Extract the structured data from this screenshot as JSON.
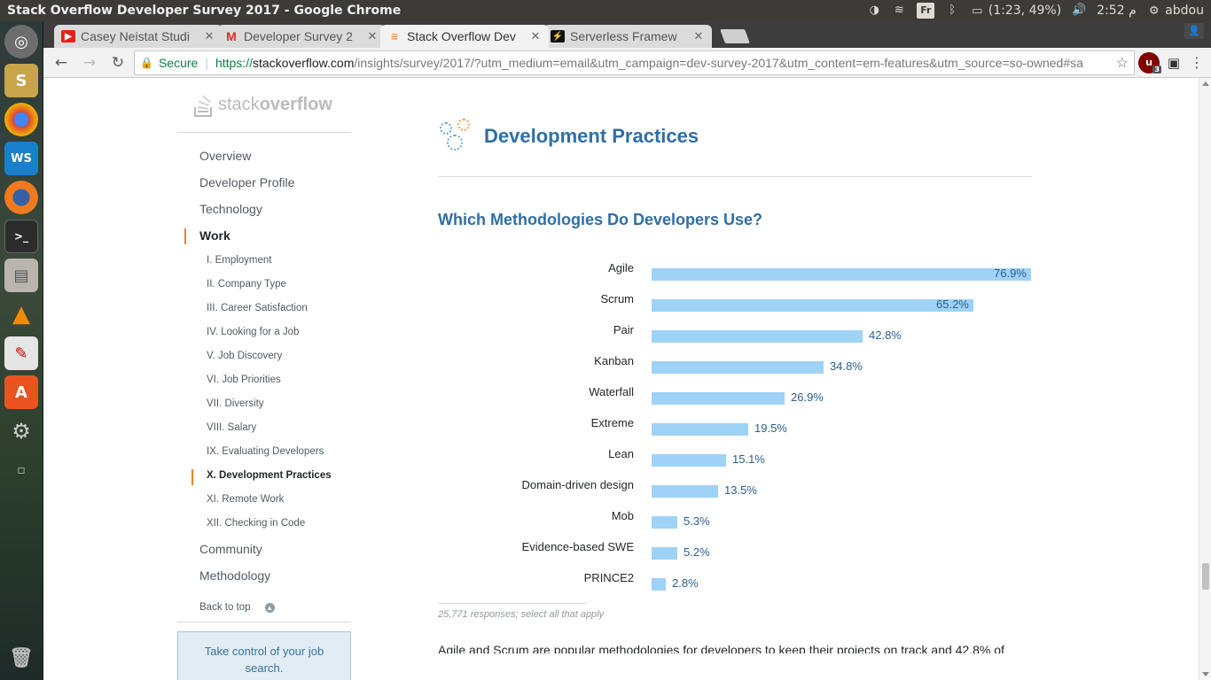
{
  "top_panel": {
    "window_title": "Stack Overflow Developer Survey 2017 - Google Chrome",
    "indicator_box": "Fr",
    "battery": "(1:23, 49%)",
    "clock": "م 2:52",
    "user": "abdou"
  },
  "tabs": [
    {
      "label": "Casey Neistat Studi",
      "favicon": "youtube-icon",
      "color": "#e62117"
    },
    {
      "label": "Developer Survey 2",
      "favicon": "gmail-icon",
      "color": "#d93025"
    },
    {
      "label": "Stack Overflow Dev",
      "favicon": "stackoverflow-icon",
      "color": "#f48024"
    },
    {
      "label": "Serverless Framew",
      "favicon": "serverless-icon",
      "color": "#fd5750"
    }
  ],
  "address_bar": {
    "secure_label": "Secure",
    "url_scheme": "https://",
    "url_host": "stackoverflow.com",
    "url_rest": "/insights/survey/2017/?utm_medium=email&utm_campaign=dev-survey-2017&utm_content=em-features&utm_source=so-owned#sa"
  },
  "extensions": {
    "ublock_count": "3"
  },
  "sidebar": {
    "logo_light": "stack",
    "logo_bold": "overflow",
    "main_items": [
      {
        "label": "Overview"
      },
      {
        "label": "Developer Profile"
      },
      {
        "label": "Technology"
      },
      {
        "label": "Work"
      }
    ],
    "sub_items": [
      {
        "label": "I. Employment"
      },
      {
        "label": "II. Company Type"
      },
      {
        "label": "III. Career Satisfaction"
      },
      {
        "label": "IV. Looking for a Job"
      },
      {
        "label": "V. Job Discovery"
      },
      {
        "label": "VI. Job Priorities"
      },
      {
        "label": "VII. Diversity"
      },
      {
        "label": "VIII. Salary"
      },
      {
        "label": "IX. Evaluating Developers"
      },
      {
        "label": "X. Development Practices"
      },
      {
        "label": "XI. Remote Work"
      },
      {
        "label": "XII. Checking in Code"
      }
    ],
    "bottom_items": [
      {
        "label": "Community"
      },
      {
        "label": "Methodology"
      }
    ],
    "back_to_top": "Back to top",
    "promo_text": "Take control of your job search."
  },
  "main": {
    "section_title": "Development Practices",
    "question_title": "Which Methodologies Do Developers Use?",
    "footnote": "25,771 responses; select all that apply",
    "paragraph_partial": "Agile and Scrum are popular methodologies for developers to keep their projects on track and 42.8% of"
  },
  "colors": {
    "bar": "#9fd2f7",
    "heading": "#2f6fa6",
    "accent": "#f48024"
  },
  "chart_data": {
    "type": "bar",
    "orientation": "horizontal",
    "categories": [
      "Agile",
      "Scrum",
      "Pair",
      "Kanban",
      "Waterfall",
      "Extreme",
      "Lean",
      "Domain-driven design",
      "Mob",
      "Evidence-based SWE",
      "PRINCE2"
    ],
    "values": [
      76.9,
      65.2,
      42.8,
      34.8,
      26.9,
      19.5,
      15.1,
      13.5,
      5.3,
      5.2,
      2.8
    ],
    "value_labels": [
      "76.9%",
      "65.2%",
      "42.8%",
      "34.8%",
      "26.9%",
      "19.5%",
      "15.1%",
      "13.5%",
      "5.3%",
      "5.2%",
      "2.8%"
    ],
    "xlim": [
      0,
      76.9
    ]
  }
}
